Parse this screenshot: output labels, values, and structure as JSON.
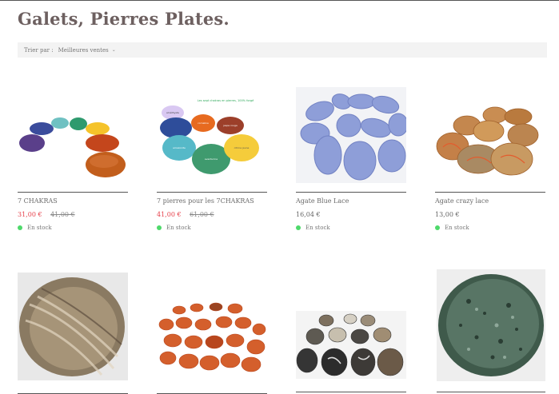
{
  "page": {
    "title": "Galets, Pierres Plates."
  },
  "sort": {
    "label": "Trier par :",
    "value": "Meilleures ventes",
    "chevron_icon": "chevron-down-icon"
  },
  "colors": {
    "sale_price": "#e6414b",
    "in_stock_dot": "#4ed96b",
    "title": "#6d6060"
  },
  "products": [
    {
      "name": "7 CHAKRAS",
      "price": "31,00 €",
      "old_price": "41,00 €",
      "stock": "En stock"
    },
    {
      "name": "7 pierres pour les 7CHAKRAS",
      "price": "41,00 €",
      "old_price": "61,00 €",
      "stock": "En stock"
    },
    {
      "name": "Agate Blue Lace",
      "price": "16,04 €",
      "stock": "En stock"
    },
    {
      "name": "Agate crazy lace",
      "price": "13,00 €",
      "stock": "En stock"
    }
  ],
  "image_captions": {
    "p2": "Les sept chakras en pierres, 100% forgé à Mexico de quartz",
    "p2_labels": [
      "améthyste",
      "quartz",
      "cornaline",
      "sodalite",
      "jaspe rouge",
      "amazonite",
      "aventurine",
      "citrine jaune"
    ]
  }
}
